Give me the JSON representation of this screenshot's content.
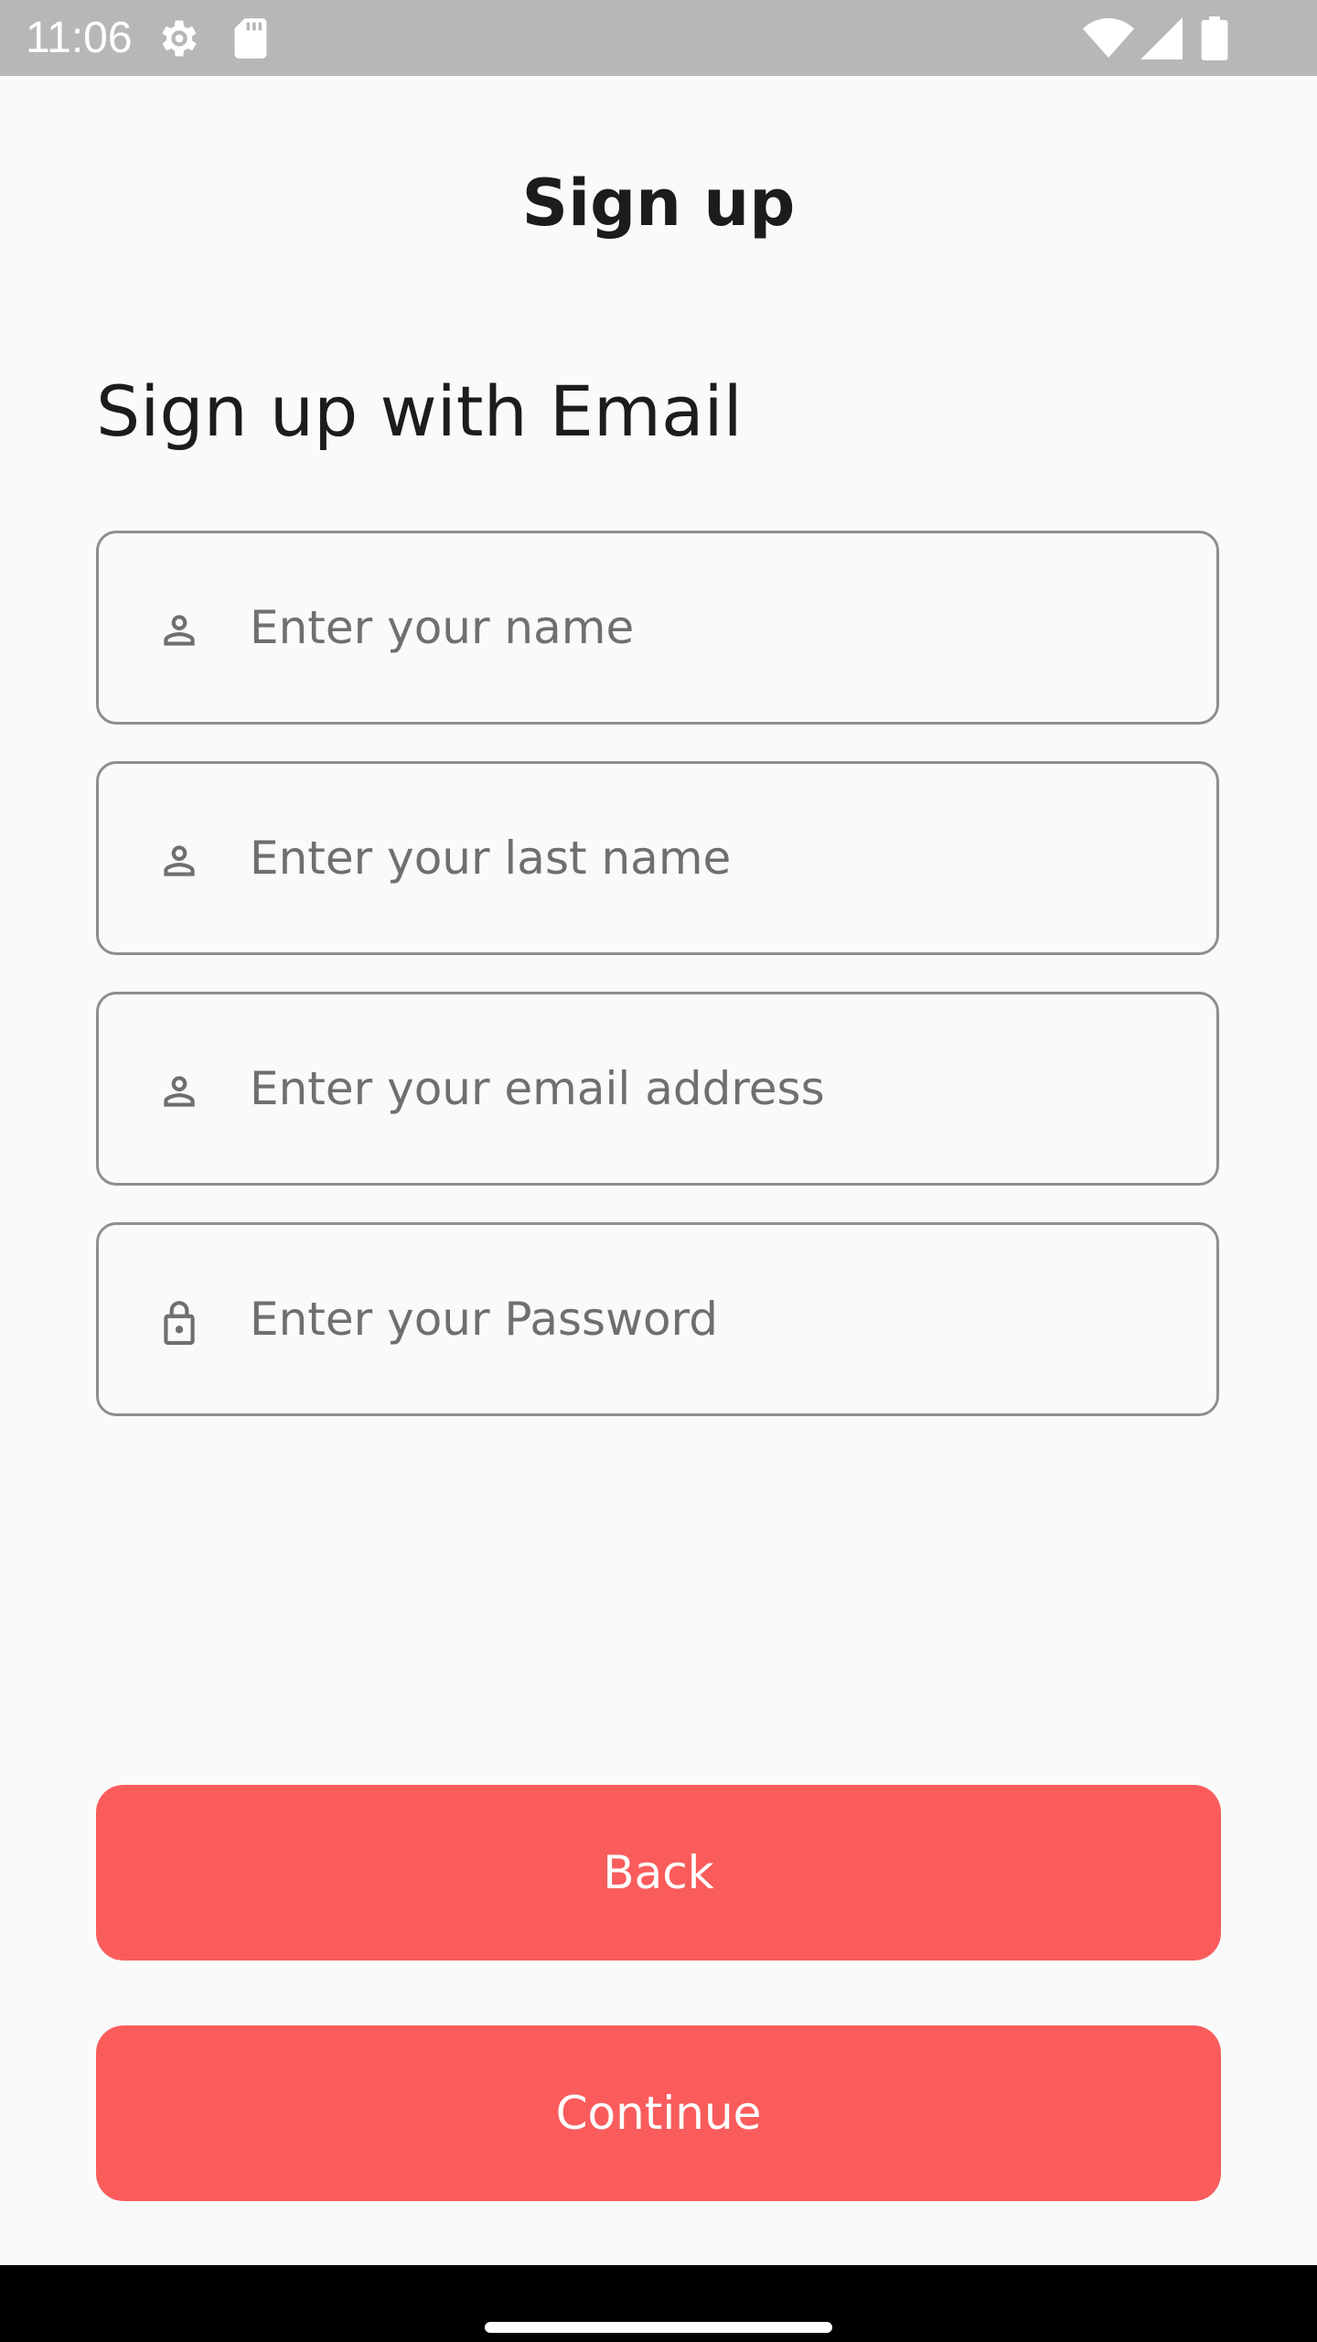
{
  "status_bar": {
    "time": "11:06",
    "icons": [
      "settings-gear-icon",
      "sd-card-icon",
      "wifi-icon",
      "cellular-signal-icon",
      "battery-icon"
    ]
  },
  "app_bar": {
    "title": "Sign up"
  },
  "form": {
    "heading": "Sign up with Email",
    "fields": [
      {
        "icon": "person-icon",
        "placeholder": "Enter your name",
        "value": ""
      },
      {
        "icon": "person-icon",
        "placeholder": "Enter your last name",
        "value": ""
      },
      {
        "icon": "person-icon",
        "placeholder": "Enter your email address",
        "value": ""
      },
      {
        "icon": "lock-icon",
        "placeholder": "Enter your Password",
        "value": ""
      }
    ]
  },
  "buttons": {
    "back_label": "Back",
    "continue_label": "Continue"
  },
  "colors": {
    "accent": "#fa5c5c",
    "status_bar": "#b7b7b7",
    "background": "#fafafa",
    "field_border": "#8e8e8e"
  }
}
